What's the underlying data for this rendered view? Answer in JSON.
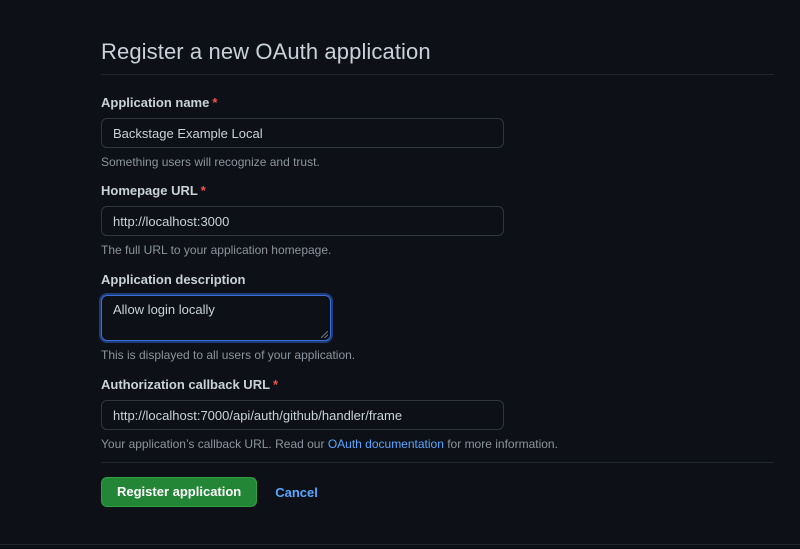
{
  "page": {
    "title": "Register a new OAuth application"
  },
  "form": {
    "app_name": {
      "label": "Application name",
      "required_mark": "*",
      "value": "Backstage Example Local",
      "note": "Something users will recognize and trust."
    },
    "homepage_url": {
      "label": "Homepage URL",
      "required_mark": "*",
      "value": "http://localhost:3000",
      "note": "The full URL to your application homepage."
    },
    "description": {
      "label": "Application description",
      "value": "Allow login locally",
      "note": "This is displayed to all users of your application."
    },
    "callback_url": {
      "label": "Authorization callback URL",
      "required_mark": "*",
      "value": "http://localhost:7000/api/auth/github/handler/frame",
      "note_prefix": "Your application’s callback URL. Read our ",
      "note_link": "OAuth documentation",
      "note_suffix": " for more information."
    }
  },
  "actions": {
    "register_label": "Register application",
    "cancel_label": "Cancel"
  },
  "colors": {
    "background": "#0d1117",
    "primary_button": "#238636",
    "link": "#58a6ff",
    "required": "#f85149"
  }
}
